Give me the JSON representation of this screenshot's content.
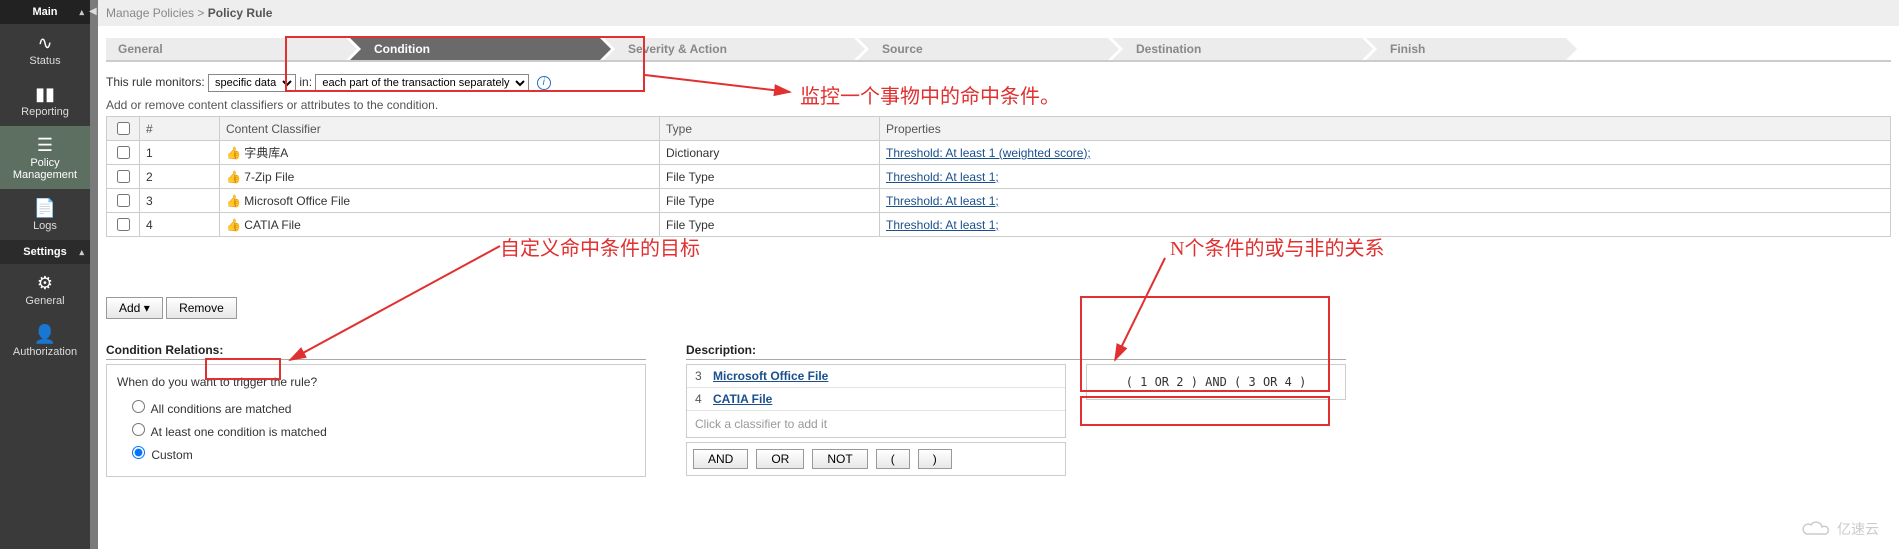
{
  "sidebar": {
    "header_main": "Main",
    "header_settings": "Settings",
    "items": {
      "status": "Status",
      "reporting": "Reporting",
      "policy": "Policy\nManagement",
      "logs": "Logs",
      "general": "General",
      "auth": "Authorization"
    }
  },
  "breadcrumb": {
    "a": "Manage Policies",
    "sep": " > ",
    "b": "Policy Rule"
  },
  "wizard": [
    "General",
    "Condition",
    "Severity & Action",
    "Source",
    "Destination",
    "Finish"
  ],
  "ruleline": {
    "label": "This rule monitors:",
    "sel1": "specific data",
    "mid": "in:",
    "sel2": "each part of the transaction separately"
  },
  "hint": "Add or remove content classifiers or attributes to the condition.",
  "table": {
    "cols": [
      "#",
      "Content Classifier",
      "Type",
      "Properties"
    ],
    "rows": [
      {
        "n": "1",
        "c": "字典库A",
        "t": "Dictionary",
        "p": "Threshold: At least 1 (weighted score);"
      },
      {
        "n": "2",
        "c": "7-Zip File",
        "t": "File Type",
        "p": "Threshold: At least 1;"
      },
      {
        "n": "3",
        "c": "Microsoft Office File",
        "t": "File Type",
        "p": "Threshold: At least 1;"
      },
      {
        "n": "4",
        "c": "CATIA File",
        "t": "File Type",
        "p": "Threshold: At least 1;"
      }
    ]
  },
  "buttons": {
    "add": "Add",
    "remove": "Remove"
  },
  "relations": {
    "title": "Condition Relations:",
    "q": "When do you want to trigger the rule?",
    "opt1": "All conditions are matched",
    "opt2": "At least one condition is matched",
    "opt3": "Custom"
  },
  "description": {
    "title": "Description:",
    "rows": [
      {
        "n": "3",
        "t": "Microsoft Office File"
      },
      {
        "n": "4",
        "t": "CATIA File"
      }
    ],
    "hint": "Click a classifier to add it"
  },
  "logic": {
    "and": "AND",
    "or": "OR",
    "not": "NOT",
    "lp": "(",
    "rp": ")"
  },
  "expr": "( 1 OR 2 ) AND ( 3 OR 4 )",
  "annot": {
    "a1": "监控一个事物中的命中条件。",
    "a2": "自定义命中条件的目标",
    "a3": "N个条件的或与非的关系"
  },
  "watermark": "亿速云"
}
